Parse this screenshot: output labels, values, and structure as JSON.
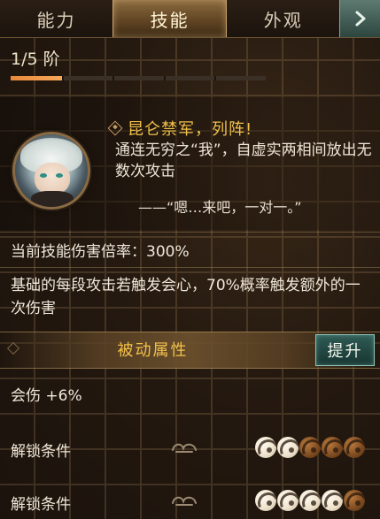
{
  "tabs": [
    {
      "label": "能力"
    },
    {
      "label": "技能",
      "active": true
    },
    {
      "label": "外观"
    }
  ],
  "tier": {
    "label": "1/5 阶",
    "current": 1,
    "max": 5
  },
  "skill": {
    "title": "昆仑禁军，列阵!",
    "description": "通连无穷之“我”，自虚实两相间放出无数次攻击",
    "quote": "——“嗯…来吧，一对一。”"
  },
  "damage_rate": "当前技能伤害倍率：300%",
  "extra_effect": "基础的每段攻击若触发会心，70%概率触发额外的一次伤害",
  "passive": {
    "title": "被动属性",
    "upgrade_label": "提升",
    "stat": "会伤 +6%"
  },
  "unlock_rows": [
    {
      "label": "解锁条件",
      "beads_lit": 2,
      "beads_total": 5
    },
    {
      "label": "解锁条件",
      "beads_lit": 4,
      "beads_total": 5
    }
  ],
  "colors": {
    "accent_gold": "#f2c14a",
    "progress_orange": "#e8893a",
    "teal_button": "#2f5a54"
  }
}
